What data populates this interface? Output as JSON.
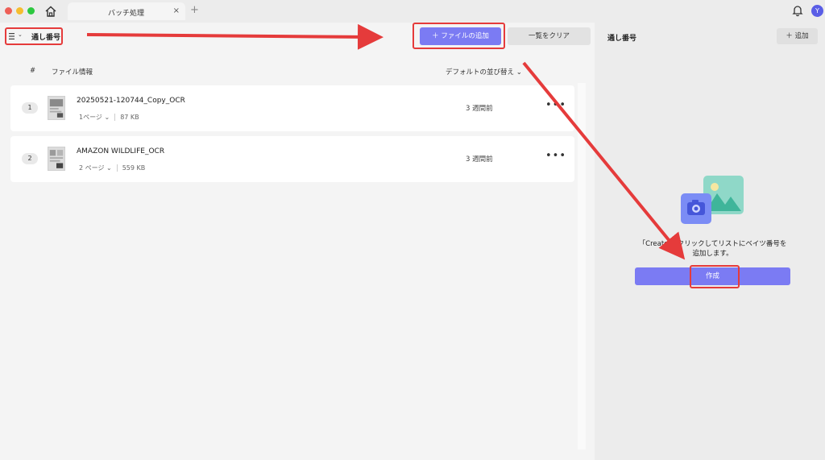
{
  "titlebar": {
    "tab_label": "バッチ処理",
    "tab_close": "×",
    "new_tab": "+",
    "avatar_letter": "Y",
    "traffic_colors": [
      "#ee5f57",
      "#f5bd2f",
      "#2dc840"
    ]
  },
  "toolbar": {
    "menu_label": "通し番号",
    "add_file_label": "＋ ファイルの追加",
    "clear_label": "一覧をクリア"
  },
  "table": {
    "col_number": "#",
    "col_file_info": "ファイル情報",
    "sort_label": "デフォルトの並び替え ⌄"
  },
  "files": [
    {
      "number": "1",
      "name": "20250521-120744_Copy_OCR",
      "pages": "1ページ ⌄",
      "size": "87 KB",
      "time": "3 週間前",
      "more": "•••"
    },
    {
      "number": "2",
      "name": "AMAZON WILDLIFE_OCR",
      "pages": "2 ページ ⌄",
      "size": "559 KB",
      "time": "3 週間前",
      "more": "•••"
    }
  ],
  "right_panel": {
    "title": "通し番号",
    "add_label": "＋ 追加",
    "description_line1": "「Create」 クリックしてリストにベイツ番号を",
    "description_line2": "追加します。",
    "create_label": "作成"
  },
  "colors": {
    "accent": "#7b7bf3",
    "highlight": "#e53b3b"
  }
}
